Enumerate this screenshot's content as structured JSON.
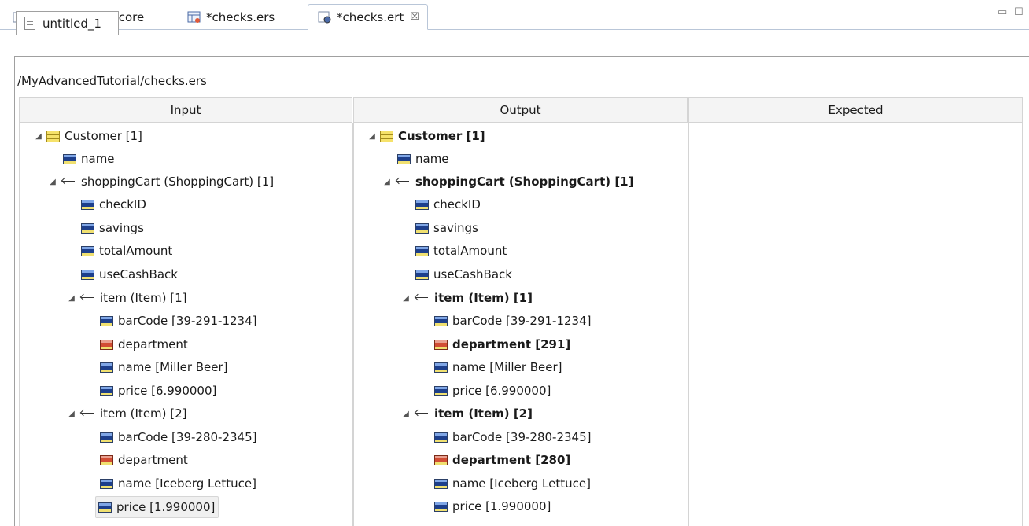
{
  "editor_tabs": [
    {
      "label": "groceryStore.ecore",
      "icon": "ecore-model-icon"
    },
    {
      "label": "*checks.ers",
      "icon": "ruleset-icon"
    },
    {
      "label": "*checks.ert",
      "icon": "rule-test-icon",
      "active": true,
      "close": "☒"
    }
  ],
  "window_controls": {
    "minimize": "▭",
    "maximize": "☐"
  },
  "inner_tab": {
    "label": "untitled_1"
  },
  "path": "/MyAdvancedTutorial/checks.ers",
  "columns": {
    "input": "Input",
    "output": "Output",
    "expected": "Expected"
  },
  "input_tree": {
    "root": "Customer [1]",
    "name": "name",
    "cart": "shoppingCart (ShoppingCart) [1]",
    "checkID": "checkID",
    "savings": "savings",
    "totalAmount": "totalAmount",
    "useCashBack": "useCashBack",
    "item1": "item (Item) [1]",
    "item1_barcode": "barCode [39-291-1234]",
    "item1_department": "department",
    "item1_name": "name [Miller Beer]",
    "item1_price": "price [6.990000]",
    "item2": "item (Item) [2]",
    "item2_barcode": "barCode [39-280-2345]",
    "item2_department": "department",
    "item2_name": "name [Iceberg Lettuce]",
    "item2_price": "price [1.990000]"
  },
  "output_tree": {
    "root": "Customer [1]",
    "name": "name",
    "cart": "shoppingCart (ShoppingCart) [1]",
    "checkID": "checkID",
    "savings": "savings",
    "totalAmount": "totalAmount",
    "useCashBack": "useCashBack",
    "item1": "item (Item) [1]",
    "item1_barcode": "barCode [39-291-1234]",
    "item1_department": "department [291]",
    "item1_name": "name [Miller Beer]",
    "item1_price": "price [6.990000]",
    "item2": "item (Item) [2]",
    "item2_barcode": "barCode [39-280-2345]",
    "item2_department": "department [280]",
    "item2_name": "name [Iceberg Lettuce]",
    "item2_price": "price [1.990000]"
  },
  "colors": {
    "border": "#d4d4d4",
    "header_bg": "#f4f4f4",
    "attr_icon": "#1d3f8c",
    "changed_icon": "#d24d34"
  }
}
